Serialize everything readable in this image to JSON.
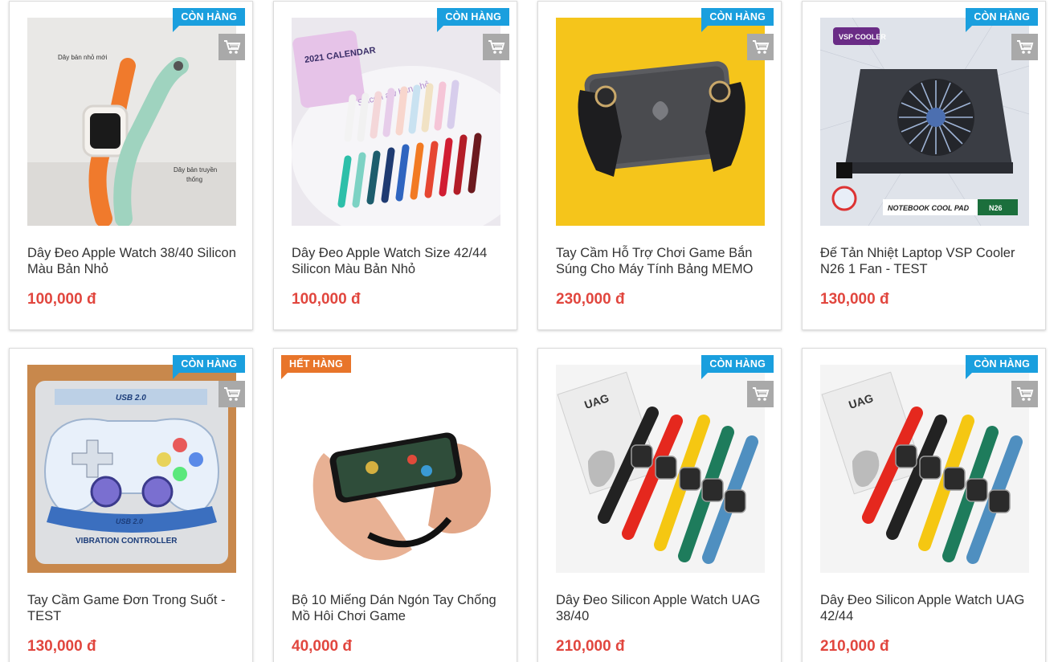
{
  "colors": {
    "in_stock": "#1a9fde",
    "out_of_stock": "#e8752a",
    "price": "#e1463e",
    "cart_button": "#a9a9a9"
  },
  "products": [
    {
      "name": "Dây Đeo Apple Watch 38/40 Silicon Màu Bản Nhỏ",
      "price": "100,000 đ",
      "status": "CÒN HÀNG",
      "status_type": "in",
      "image_text": [
        "Dây bản nhỏ mới",
        "Dây bản truyền",
        "thống"
      ]
    },
    {
      "name": "Dây Đeo Apple Watch Size 42/44 Silicon Màu Bản Nhỏ",
      "price": "100,000 đ",
      "status": "CÒN HÀNG",
      "status_type": "in",
      "image_text": [
        "2021 CALENDAR",
        "Silicon aw bản nhỏ"
      ]
    },
    {
      "name": "Tay Cầm Hỗ Trợ Chơi Game Bắn Súng Cho Máy Tính Bảng MEMO",
      "price": "230,000 đ",
      "status": "CÒN HÀNG",
      "status_type": "in",
      "image_text": []
    },
    {
      "name": "Đế Tản Nhiệt Laptop VSP Cooler N26 1 Fan - TEST",
      "price": "130,000 đ",
      "status": "CÒN HÀNG",
      "status_type": "in",
      "image_text": [
        "VSP COOLER",
        "NOTEBOOK COOL PAD",
        "N26"
      ]
    },
    {
      "name": "Tay Cầm Game Đơn Trong Suốt - TEST",
      "price": "130,000 đ",
      "status": "CÒN HÀNG",
      "status_type": "in",
      "image_text": [
        "USB 2.0",
        "VIBRATION CONTROLLER"
      ]
    },
    {
      "name": "Bộ 10 Miếng Dán Ngón Tay Chống Mồ Hôi Chơi Game",
      "price": "40,000 đ",
      "status": "HẾT HÀNG",
      "status_type": "out",
      "image_text": []
    },
    {
      "name": "Dây Đeo Silicon Apple Watch UAG 38/40",
      "price": "210,000 đ",
      "status": "CÒN HÀNG",
      "status_type": "in",
      "image_text": [
        "UAG"
      ]
    },
    {
      "name": "Dây Đeo Silicon Apple Watch UAG 42/44",
      "price": "210,000 đ",
      "status": "CÒN HÀNG",
      "status_type": "in",
      "image_text": [
        "UAG"
      ]
    }
  ],
  "icons": {
    "cart": "shopping-cart-icon"
  }
}
